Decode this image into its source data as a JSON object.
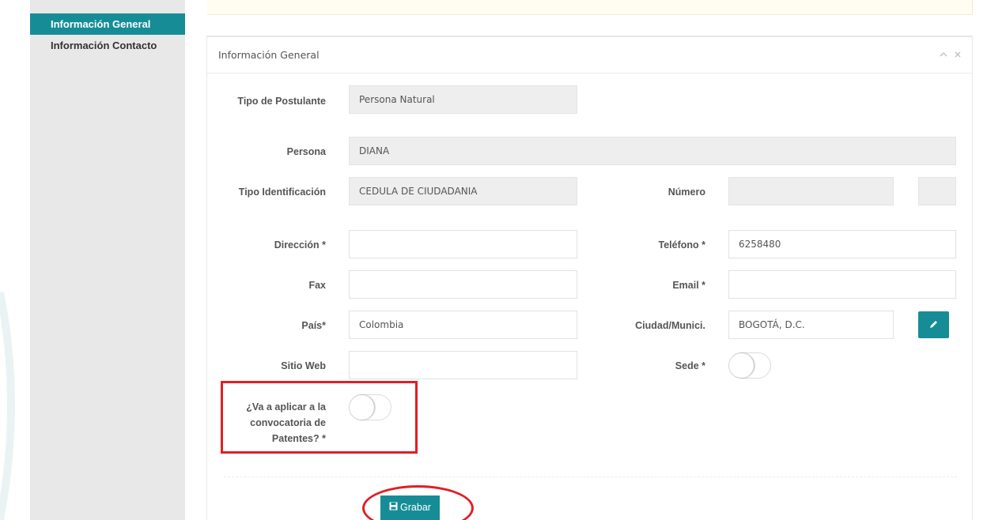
{
  "sidebar": {
    "items": [
      {
        "label": "Información General"
      },
      {
        "label": "Información Contacto"
      }
    ]
  },
  "panel": {
    "title": "Información General",
    "tools": {
      "collapse": "^",
      "close": "x"
    }
  },
  "form": {
    "tipo_postulante": {
      "label": "Tipo de Postulante",
      "value": "Persona Natural"
    },
    "persona": {
      "label": "Persona",
      "value": "DIANA"
    },
    "tipo_identificacion": {
      "label": "Tipo Identificación",
      "value": "CEDULA DE CIUDADANIA"
    },
    "numero": {
      "label": "Número",
      "value": "",
      "value2": ""
    },
    "direccion": {
      "label": "Dirección *",
      "value": ""
    },
    "telefono": {
      "label": "Teléfono *",
      "value": "6258480"
    },
    "fax": {
      "label": "Fax",
      "value": ""
    },
    "email": {
      "label": "Email *",
      "value": ""
    },
    "pais": {
      "label": "País*",
      "value": "Colombia"
    },
    "ciudad": {
      "label": "Ciudad/Munici.",
      "value": "BOGOTÁ, D.C."
    },
    "sitio_web": {
      "label": "Sitio Web",
      "value": ""
    },
    "sede": {
      "label": "Sede *",
      "on": false
    },
    "patentes": {
      "label": "¿Va a aplicar a la convocatoria de Patentes? *",
      "on": false
    }
  },
  "actions": {
    "save_label": "Grabar"
  },
  "colors": {
    "accent": "#168d96",
    "highlight": "#e31e24",
    "readonly_bg": "#eeeeee"
  }
}
